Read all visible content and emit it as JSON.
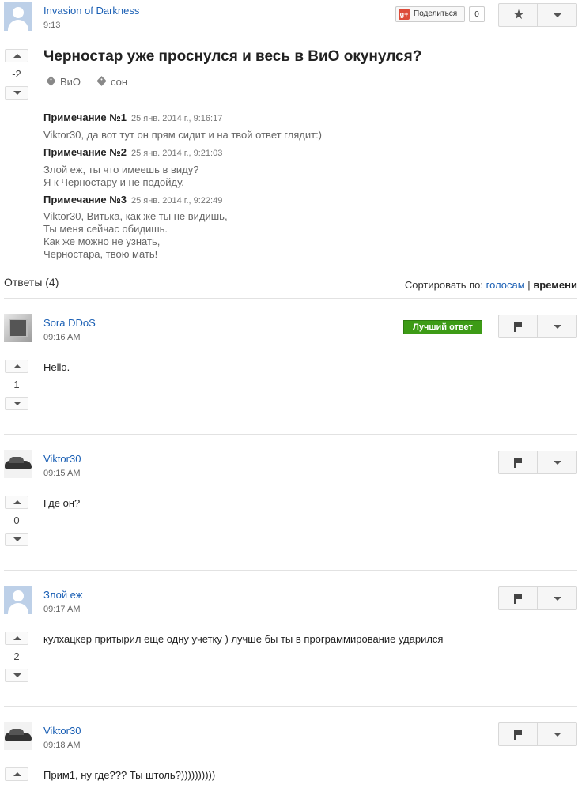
{
  "question": {
    "author": "Invasion of Darkness",
    "time": "9:13",
    "title": "Черностар уже проснулся и весь в ВиО окунулся?",
    "score": "-2",
    "tags": [
      "ВиО",
      "сон"
    ],
    "share": {
      "label": "Поделиться",
      "count": "0",
      "icon_text": "g+"
    },
    "notes": [
      {
        "title": "Примечание №1",
        "date": "25 янв. 2014 г., 9:16:17",
        "lines": [
          "Viktor30, да вот тут он прям сидит и на твой ответ глядит:)"
        ]
      },
      {
        "title": "Примечание №2",
        "date": "25 янв. 2014 г., 9:21:03",
        "lines": [
          "Злой еж, ты что имеешь в виду?",
          "Я к Черностару и не подойду."
        ]
      },
      {
        "title": "Примечание №3",
        "date": "25 янв. 2014 г., 9:22:49",
        "lines": [
          "Viktor30, Витька, как же ты не видишь,",
          "Ты меня сейчас обидишь.",
          "Как же можно не узнать,",
          "Черностара, твою мать!"
        ]
      }
    ]
  },
  "answers_header": {
    "title": "Ответы (4)",
    "sort_label": "Сортировать по:",
    "sort_votes": "голосам",
    "sort_sep": "|",
    "sort_time": "времени"
  },
  "answers": [
    {
      "author": "Sora DDoS",
      "time": "09:16 AM",
      "text": "Hello.",
      "score": "1",
      "best_label": "Лучший ответ",
      "avatar": "chip"
    },
    {
      "author": "Viktor30",
      "time": "09:15 AM",
      "text": "Где он?",
      "score": "0",
      "avatar": "car"
    },
    {
      "author": "Злой еж",
      "time": "09:17 AM",
      "text": "кулхацкер притырил еще одну учетку ) лучше бы ты в программирование ударился",
      "score": "2",
      "avatar": "default"
    },
    {
      "author": "Viktor30",
      "time": "09:18 AM",
      "text": "Прим1, ну где??? Ты штоль?))))))))))",
      "score": "",
      "avatar": "car"
    }
  ],
  "colors": {
    "link": "#1a5fb4",
    "best_badge": "#3d9b16"
  },
  "icons": [
    "star-icon",
    "chevron-down-icon",
    "flag-icon",
    "tag-icon",
    "google-plus-icon",
    "upvote-icon",
    "downvote-icon"
  ]
}
